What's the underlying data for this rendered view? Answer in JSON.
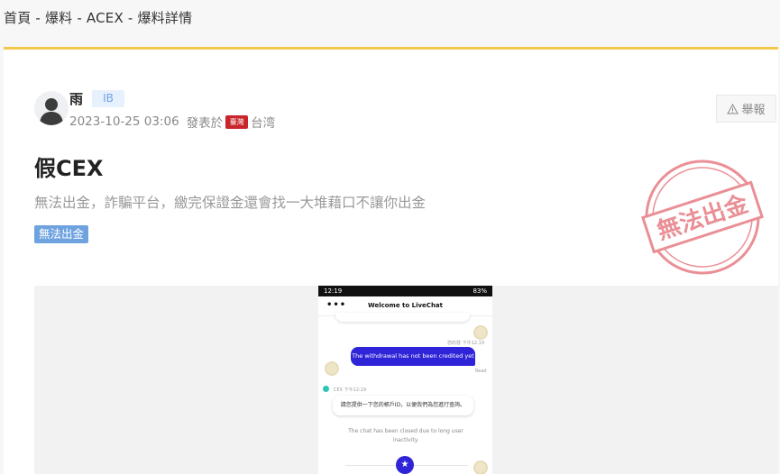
{
  "breadcrumb": "首頁 - 爆料 - ACEX - 爆料詳情",
  "post": {
    "author": "雨",
    "badge": "IB",
    "date": "2023-10-25 03:06",
    "posted_from": "發表於",
    "flag_label": "臺灣",
    "region": "台湾",
    "report_label": "舉報",
    "title": "假CEX",
    "summary": "無法出金，詐騙平台，繳完保證金還會找一大堆藉口不讓你出金",
    "tag": "無法出金",
    "stamp_text": "無法出金"
  },
  "screenshot": {
    "status_time": "12:19",
    "status_right": "83%",
    "chat_title": "Welcome to LiveChat",
    "menu_dots": "•••",
    "timestamp_user": "您的發 下午12:19",
    "user_message": "The withdrawal has not been credited yet",
    "read_label": "Read",
    "agent_name": "CEX 下午12:19",
    "agent_message": "請您提供一下您的帳戶ID，以便我們為您進行查詢。",
    "system_message": "The chat has been closed due to long user inactivity.",
    "star_icon": "★"
  },
  "colors": {
    "accent_line": "#f2c94c",
    "tag_blue": "#6fa3e0",
    "stamp_red": "#d9353f",
    "chat_blue": "#2f24d8"
  }
}
